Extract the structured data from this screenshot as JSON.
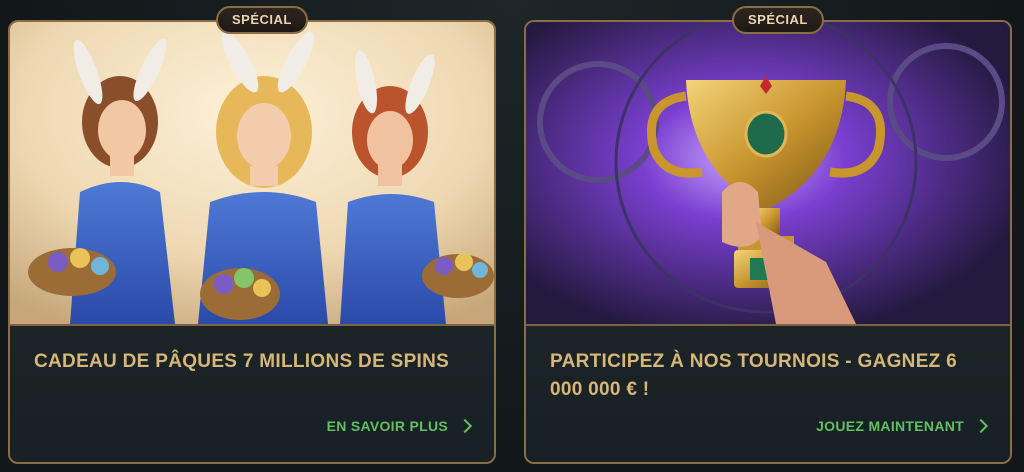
{
  "colors": {
    "gold_border": "#8a6d43",
    "title_gold": "#d7b679",
    "cta_green": "#62bf62",
    "card_bg": "#1a2125",
    "page_bg": "#141a1c"
  },
  "promos": [
    {
      "badge": "SPÉCIAL",
      "title": "CADEAU DE PÂQUES 7 MILLIONS DE SPINS",
      "cta": "EN SAVOIR PLUS",
      "cta_icon": "chevron-right-icon",
      "image": "easter-bunny-girls-illustration"
    },
    {
      "badge": "SPÉCIAL",
      "title": "PARTICIPEZ À NOS TOURNOIS - GAGNEZ 6 000 000 € !",
      "cta": "JOUEZ MAINTENANT",
      "cta_icon": "chevron-right-icon",
      "image": "golden-trophy-egyptian-illustration"
    }
  ]
}
